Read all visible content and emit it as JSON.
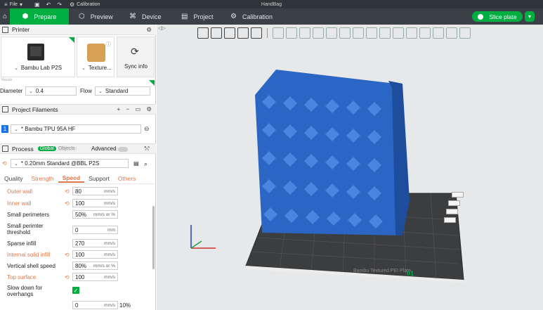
{
  "topbar": {
    "file": "File",
    "calibration": "Calibration",
    "project_title": "HandBag"
  },
  "tabs": [
    {
      "label": "Prepare"
    },
    {
      "label": "Preview"
    },
    {
      "label": "Device"
    },
    {
      "label": "Project"
    },
    {
      "label": "Calibration"
    }
  ],
  "slice_button": "Slice plate",
  "printer_section": {
    "title": "Printer",
    "printer_name": "Bambu Lab P2S",
    "plate_type": "Texture...",
    "sync_label": "Sync info",
    "nozzle_label": "Nozzle",
    "diameter_label": "Diameter",
    "diameter_value": "0.4",
    "flow_label": "Flow",
    "flow_value": "Standard"
  },
  "filaments_section": {
    "title": "Project Filaments",
    "slot_number": "1",
    "filament_name": "* Bambu TPU 95A HF"
  },
  "process_section": {
    "title": "Process",
    "global_label": "Global",
    "objects_label": "Objects",
    "advanced_label": "Advanced",
    "preset": "* 0.20mm Standard @BBL P2S",
    "tabs": [
      "Quality",
      "Strength",
      "Speed",
      "Support",
      "Others"
    ],
    "params": [
      {
        "label": "Outer wall",
        "value": "80",
        "unit": "mm/s"
      },
      {
        "label": "Inner wall",
        "value": "100",
        "unit": "mm/s"
      },
      {
        "label": "Small perimeters",
        "value": "50%",
        "unit": "mm/s or %"
      },
      {
        "label": "Small perimter",
        "label2": "threshold",
        "value": "0",
        "unit": "mm"
      },
      {
        "label": "Sparse infill",
        "value": "270",
        "unit": "mm/s"
      },
      {
        "label": "Internal solid infill",
        "value": "100",
        "unit": "mm/s"
      },
      {
        "label": "Vertical shell speed",
        "value": "80%",
        "unit": "mm/s or %"
      },
      {
        "label": "Top surface",
        "value": "100",
        "unit": "mm/s"
      },
      {
        "label": "Slow down for",
        "label2": "overhangs"
      },
      {
        "value": "0",
        "unit": "mm/s",
        "extra": "10%"
      }
    ]
  },
  "colors": {
    "accent": "#00ae42",
    "modified": "#e6774a",
    "model": "#2c66c4",
    "bed": "#3b3b3b"
  }
}
